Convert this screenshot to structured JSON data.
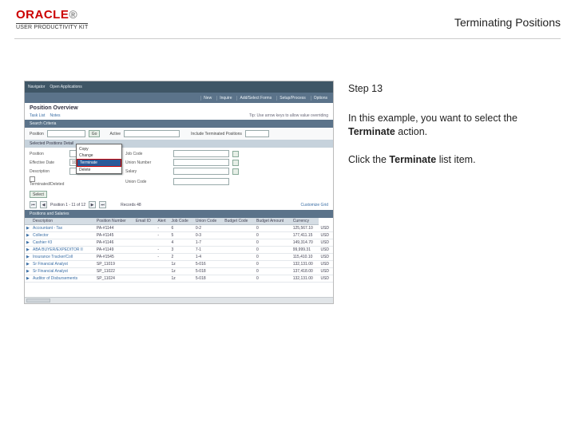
{
  "header": {
    "logo_brand": "ORACLE",
    "logo_subtitle": "USER PRODUCTIVITY KIT",
    "title": "Terminating Positions"
  },
  "instructions": {
    "step_label": "Step 13",
    "line1_pre": "In this example, you want to select the ",
    "line1_bold": "Terminate",
    "line1_post": " action.",
    "line2_pre": "Click the ",
    "line2_bold": "Terminate",
    "line2_post": " list item."
  },
  "shot": {
    "topbar": {
      "items": [
        "Navigator",
        "Open Applications"
      ]
    },
    "titlebar_buttons": [
      "New",
      "Inquire",
      "Add/Select Forms",
      "Setup/Process",
      "Options"
    ],
    "section_title": "Position Overview",
    "section_sub": {
      "links": [
        "Task List",
        "Notes"
      ],
      "hint": "Tip: Use arrow keys to allow value overriding"
    },
    "band_search": "Search Criteria",
    "filter": {
      "position_label": "Position",
      "go": "Go",
      "active_label": "Active",
      "extra_label": "Include Terminated Positions"
    },
    "dropdown_items": [
      "",
      "Copy",
      "Change",
      "Terminate",
      "Delete"
    ],
    "dropdown_selected": "Terminate",
    "band_detail": "Selected Positions Detail",
    "form": {
      "r1": {
        "l1": "Position",
        "l2": "Job Code"
      },
      "r2": {
        "l1": "Effective Date",
        "v1": "10/01/2012",
        "l2": "Union Number"
      },
      "r3": {
        "l1": "Description",
        "l2": "Salary"
      },
      "r4": {
        "cb_label": "Terminated/Deleted",
        "l2": "Union Code"
      }
    },
    "btn_select": "Select",
    "pager": {
      "text": "Position 1 - 11 of 12",
      "records": "Records 48",
      "actions": "Customize Grid"
    },
    "tbl_band": "Positions and Salaries",
    "columns": [
      "",
      "Description",
      "Position Number",
      "Email ID",
      "Alert",
      "Job Code",
      "Union Code",
      "Budget Code",
      "Budget Amount",
      "Currency"
    ],
    "rows": [
      [
        "▶",
        "Accountant - Tax",
        "PA-#1144",
        "",
        "-",
        "6",
        "0-2",
        "",
        "0",
        "125,567.10",
        "USD"
      ],
      [
        "▶",
        "Collector",
        "PA-#1145",
        "",
        "-",
        "5",
        "0-3",
        "",
        "0",
        "177,411.15",
        "USD"
      ],
      [
        "▶",
        "Cashier #3",
        "PA-#1146",
        "",
        "",
        "4",
        "1-7",
        "",
        "0",
        "149,314.70",
        "USD"
      ],
      [
        "▶",
        "ABA BUYER/EXPEDITOR II",
        "PA-#1149",
        "",
        "-",
        "3",
        "7-1",
        "",
        "0",
        "99,999.31",
        "USD"
      ],
      [
        "▶",
        "Insurance Tracker/Coll",
        "PA-#1545",
        "",
        "-",
        "2",
        "1-4",
        "",
        "0",
        "115,410.10",
        "USD"
      ],
      [
        "▶",
        "Sr Financial Analyst",
        "SP_11019",
        "",
        "",
        "1z",
        "5-016",
        "",
        "0",
        "132,131.00",
        "USD"
      ],
      [
        "▶",
        "Sr Financial Analyst",
        "SP_11022",
        "",
        "",
        "1z",
        "5-018",
        "",
        "0",
        "137,418.00",
        "USD"
      ],
      [
        "▶",
        "Auditor of Disbursements",
        "SP_11024",
        "",
        "",
        "1z",
        "5-018",
        "",
        "0",
        "132,131.00",
        "USD"
      ]
    ]
  }
}
